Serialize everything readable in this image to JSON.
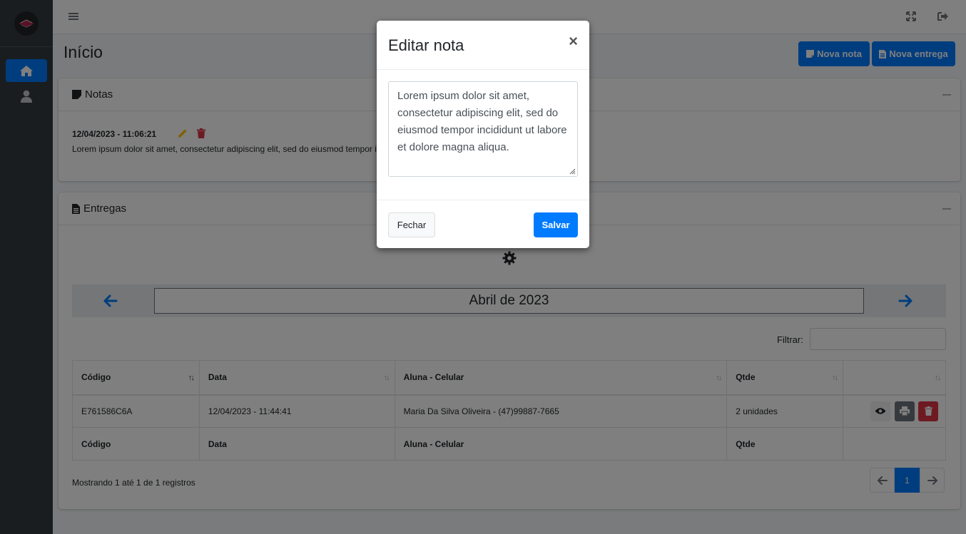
{
  "page": {
    "title": "Início"
  },
  "header_buttons": {
    "nova_nota": "Nova nota",
    "nova_entrega": "Nova entrega"
  },
  "colors": {
    "primary": "#007bff",
    "danger": "#dc3545",
    "sidebar": "#343a40",
    "warning": "#ffc107"
  },
  "notas": {
    "title": "Notas",
    "items": [
      {
        "date": "12/04/2023 - 11:06:21",
        "text": "Lorem ipsum dolor sit amet, consectetur adipiscing elit, sed do eiusmod tempor incididunt ut labore et dolore magna aliqua."
      }
    ]
  },
  "entregas": {
    "title": "Entregas",
    "month": "Abril de 2023",
    "filter_label": "Filtrar:",
    "columns": [
      "Código",
      "Data",
      "Aluna - Celular",
      "Qtde",
      ""
    ],
    "rows": [
      {
        "codigo": "E761586C6A",
        "data": "12/04/2023 - 11:44:41",
        "aluna": "Maria Da Silva Oliveira - (47)99887-7665",
        "qtde": "2 unidades"
      }
    ],
    "footer_columns": [
      "Código",
      "Data",
      "Aluna - Celular",
      "Qtde",
      ""
    ],
    "info": "Mostrando 1 até 1 de 1 registros",
    "pagination": {
      "current": "1"
    }
  },
  "modal": {
    "title": "Editar nota",
    "close": "×",
    "textarea_value": "Lorem ipsum dolor sit amet, consectetur adipiscing elit, sed do eiusmod tempor incididunt ut labore et dolore magna aliqua.",
    "fechar": "Fechar",
    "salvar": "Salvar"
  }
}
